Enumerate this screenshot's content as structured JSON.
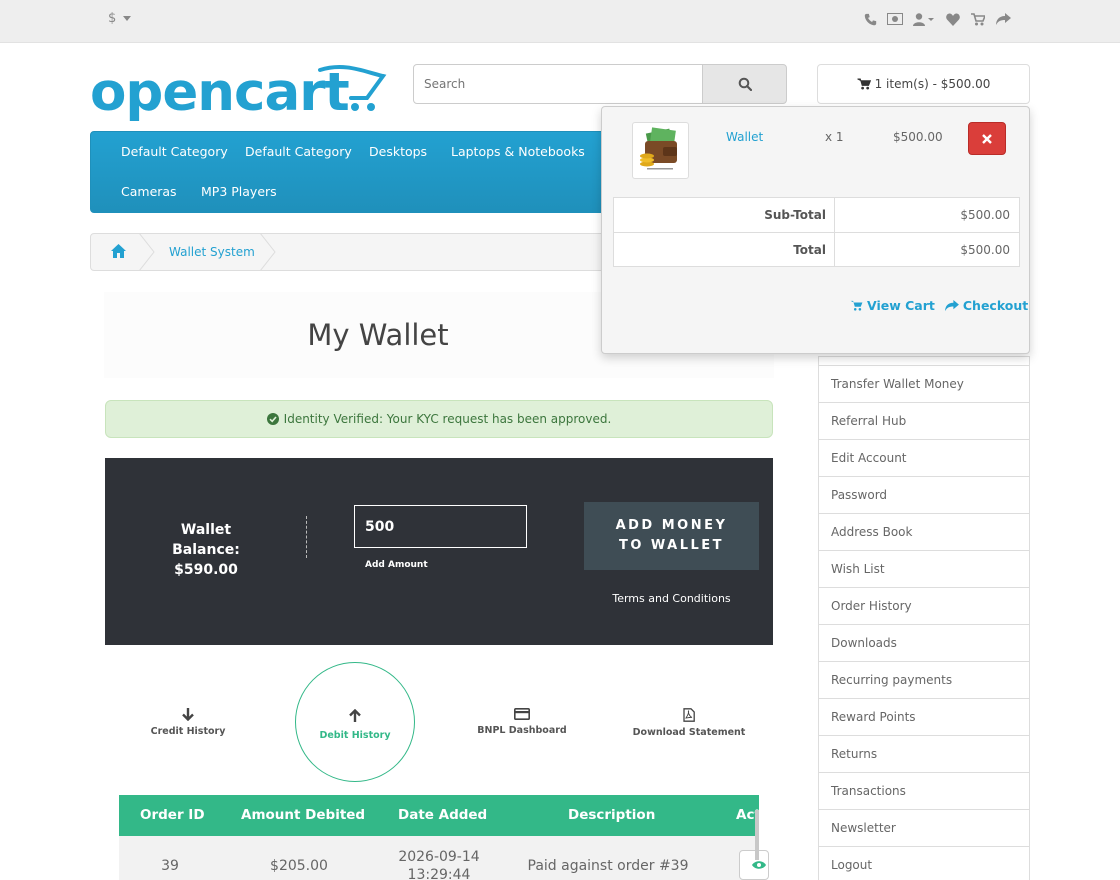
{
  "topbar": {
    "currency": "$"
  },
  "logo": {
    "text": "opencart"
  },
  "search": {
    "placeholder": "Search"
  },
  "cart": {
    "button_label": "1 item(s) - $500.00",
    "items": [
      {
        "name": "Wallet",
        "qty": "x 1",
        "price": "$500.00"
      }
    ],
    "subtotal_label": "Sub-Total",
    "subtotal_value": "$500.00",
    "total_label": "Total",
    "total_value": "$500.00",
    "view_cart": "View Cart",
    "checkout": "Checkout"
  },
  "menu": {
    "items": [
      "Default Category",
      "Default Category",
      "Desktops",
      "Laptops & Notebooks",
      "Cameras",
      "MP3 Players"
    ]
  },
  "breadcrumb": {
    "current": "Wallet System"
  },
  "page": {
    "title": "My Wallet"
  },
  "alert": {
    "text": "Identity Verified: Your KYC request has been approved."
  },
  "wallet": {
    "balance_label": "Wallet Balance:",
    "balance_value": "$590.00",
    "amount_value": "500",
    "amount_label": "Add Amount",
    "add_money_line1": "ADD MONEY",
    "add_money_line2": "TO WALLET",
    "terms": "Terms and Conditions"
  },
  "tabs": {
    "credit": "Credit History",
    "debit": "Debit History",
    "bnpl": "BNPL Dashboard",
    "statement": "Download Statement"
  },
  "table": {
    "headers": [
      "Order ID",
      "Amount Debited",
      "Date Added",
      "Description",
      "Act"
    ],
    "rows": [
      {
        "order_id": "39",
        "amount": "$205.00",
        "date": "2026-09-14",
        "time": "13:29:44",
        "description": "Paid against order #39"
      }
    ]
  },
  "account": {
    "items": [
      "Transfer Wallet Money",
      "Referral Hub",
      "Edit Account",
      "Password",
      "Address Book",
      "Wish List",
      "Order History",
      "Downloads",
      "Recurring payments",
      "Reward Points",
      "Returns",
      "Transactions",
      "Newsletter",
      "Logout"
    ]
  },
  "colors": {
    "brand_blue": "#23a1d1",
    "green": "#33b888",
    "dark_panel": "#2f3238",
    "danger": "#da3e3a"
  }
}
